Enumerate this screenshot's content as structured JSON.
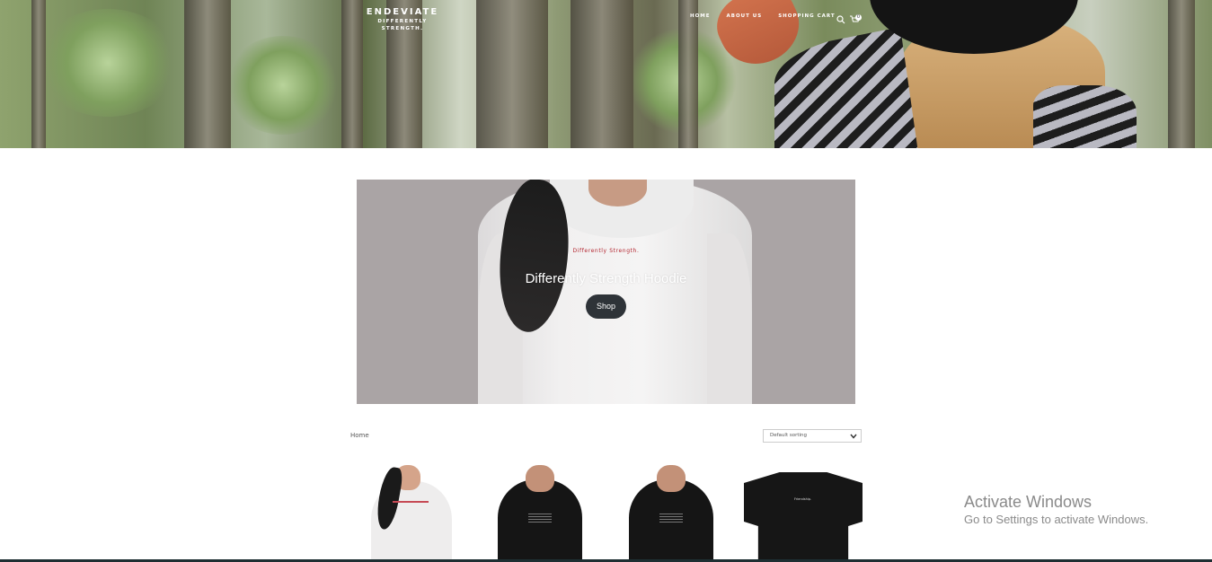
{
  "header": {
    "brand_name": "ENDEVIATE",
    "brand_tagline": "DIFFERENTLY STRENGTH.",
    "nav": [
      "HOME",
      "ABOUT US",
      "SHOPPING CART"
    ],
    "cart_count": "0"
  },
  "banner": {
    "print_text": "Differently Strength.",
    "title": "Differently Strength Hoodie",
    "button_label": "Shop"
  },
  "shop": {
    "breadcrumb": "Home",
    "sorting_selected": "Default sorting"
  },
  "products": [
    {
      "image": "white-hoodie-woman"
    },
    {
      "image": "black-hoodie-man"
    },
    {
      "image": "black-hoodie-man"
    },
    {
      "image": "black-tshirt",
      "print_text": "Friendship."
    }
  ],
  "watermark": {
    "title": "Activate Windows",
    "subtitle": "Go to Settings to activate Windows."
  },
  "icons": [
    "search-icon",
    "cart-icon",
    "chevron-down-icon"
  ],
  "colors": {
    "button_bg": "#2e3338",
    "banner_bg": "#aaa4a5",
    "print_red": "#b3242e"
  }
}
